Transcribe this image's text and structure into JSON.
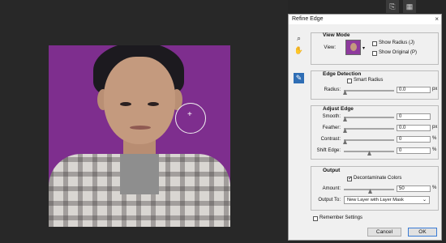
{
  "dialog": {
    "title": "Refine Edge",
    "close_icon": "×"
  },
  "tools": [
    {
      "name": "zoom-tool-icon",
      "glyph": "⌕"
    },
    {
      "name": "hand-tool-icon",
      "glyph": "✋"
    },
    {
      "name": "refine-radius-brush-icon",
      "glyph": "✎"
    }
  ],
  "view_mode": {
    "title": "View Mode",
    "view_label": "View:",
    "show_radius_label": "Show Radius (J)",
    "show_original_label": "Show Original (P)"
  },
  "edge_detection": {
    "title": "Edge Detection",
    "smart_radius_label": "Smart Radius",
    "radius_label": "Radius:",
    "radius_value": "0.0",
    "radius_unit": "px"
  },
  "adjust_edge": {
    "title": "Adjust Edge",
    "smooth_label": "Smooth:",
    "smooth_value": "0",
    "feather_label": "Feather:",
    "feather_value": "0.0",
    "feather_unit": "px",
    "contrast_label": "Contrast:",
    "contrast_value": "0",
    "contrast_unit": "%",
    "shift_edge_label": "Shift Edge:",
    "shift_edge_value": "0",
    "shift_edge_unit": "%"
  },
  "output": {
    "title": "Output",
    "decontaminate_label": "Decontaminate Colors",
    "amount_label": "Amount:",
    "amount_value": "50",
    "amount_unit": "%",
    "output_to_label": "Output To:",
    "output_to_value": "New Layer with Layer Mask"
  },
  "footer": {
    "remember_label": "Remember Settings",
    "cancel_label": "Cancel",
    "ok_label": "OK"
  },
  "colors": {
    "background_purple": "#7e2e8e",
    "selected_tool": "#2f6eb5"
  }
}
